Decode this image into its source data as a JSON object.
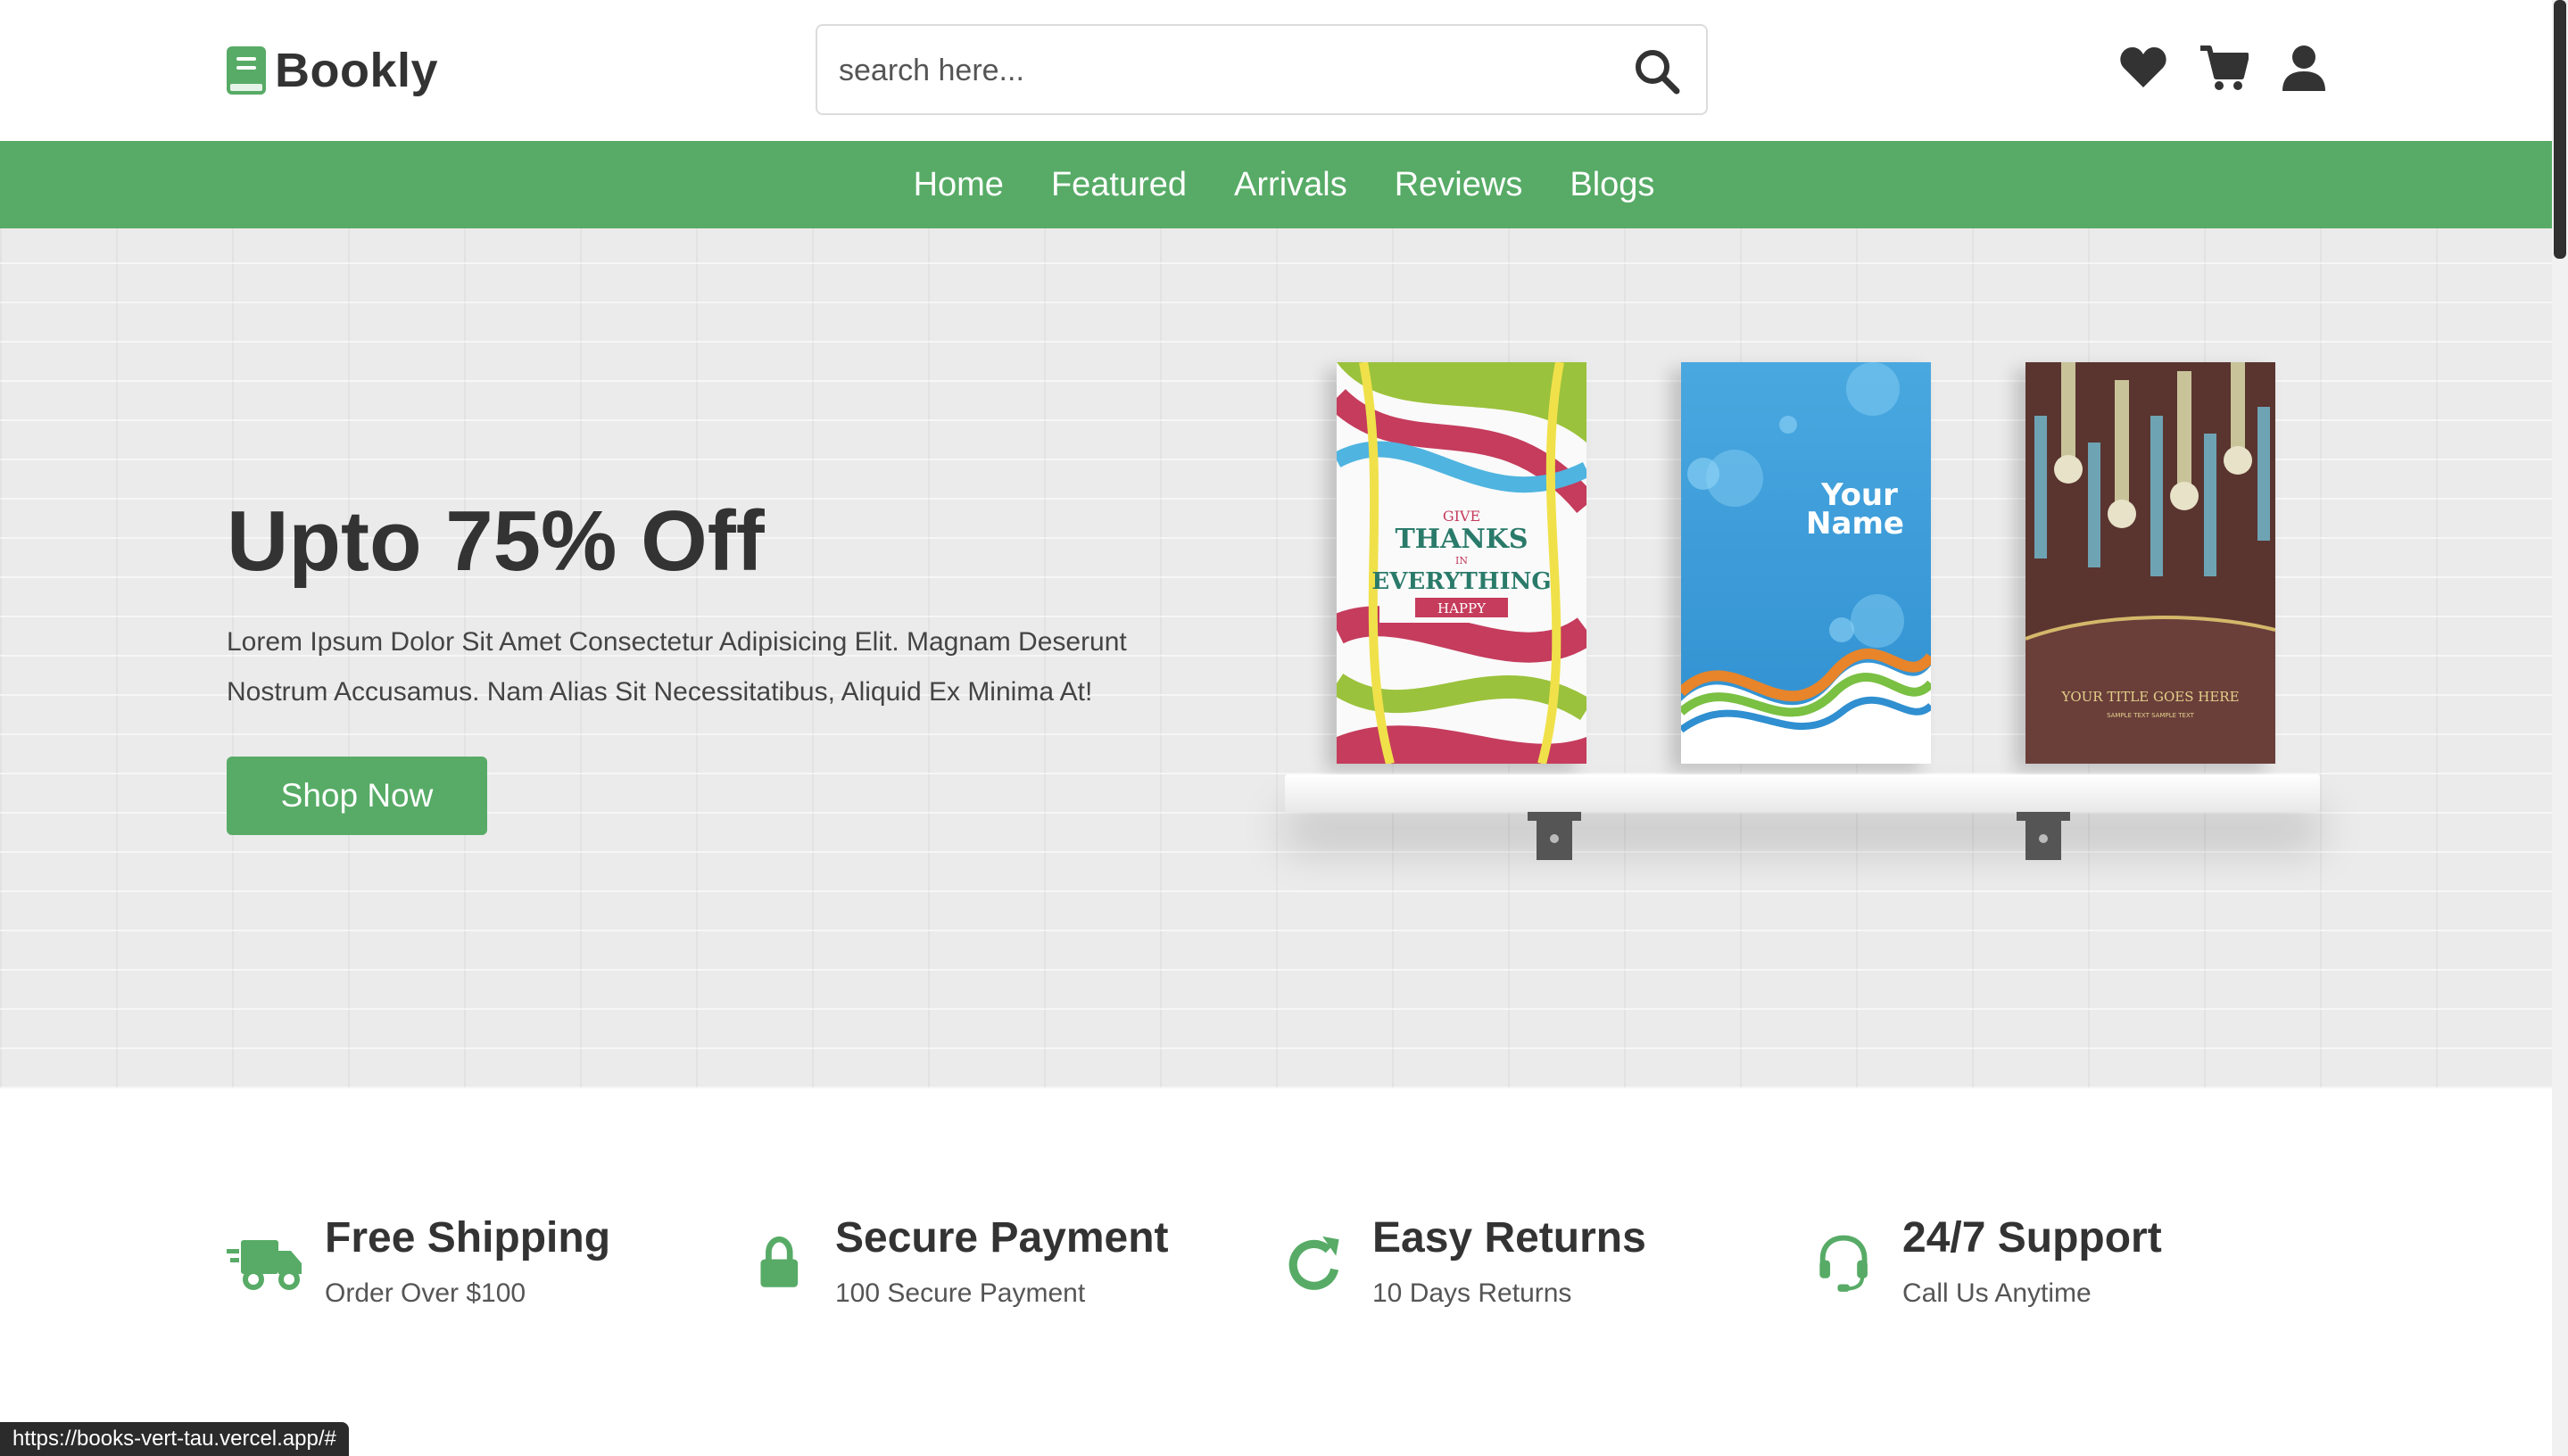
{
  "header": {
    "logo_text": "Bookly",
    "search_placeholder": "search here...",
    "icons": [
      "logo-book-icon",
      "search-icon",
      "heart-icon",
      "cart-icon",
      "user-icon"
    ]
  },
  "nav": {
    "items": [
      {
        "label": "Home"
      },
      {
        "label": "Featured"
      },
      {
        "label": "Arrivals"
      },
      {
        "label": "Reviews"
      },
      {
        "label": "Blogs"
      }
    ]
  },
  "hero": {
    "title": "Upto 75% Off",
    "description": "Lorem Ipsum Dolor Sit Amet Consectetur Adipisicing Elit. Magnam Deserunt Nostrum Accusamus. Nam Alias Sit Necessitatibus, Aliquid Ex Minima At!",
    "button_label": "Shop Now",
    "books": [
      {
        "cover_lines": [
          "GIVE",
          "THANKS",
          "IN",
          "EVERYTHING",
          "HAPPY"
        ]
      },
      {
        "cover_lines": [
          "Your",
          "Name"
        ]
      },
      {
        "cover_lines": [
          "YOUR TITLE GOES HERE",
          "SAMPLE TEXT SAMPLE TEXT"
        ]
      }
    ]
  },
  "features": [
    {
      "icon": "truck-icon",
      "title": "Free Shipping",
      "subtitle": "Order Over $100"
    },
    {
      "icon": "lock-icon",
      "title": "Secure Payment",
      "subtitle": "100 Secure Payment"
    },
    {
      "icon": "redo-icon",
      "title": "Easy Returns",
      "subtitle": "10 Days Returns"
    },
    {
      "icon": "headset-icon",
      "title": "24/7 Support",
      "subtitle": "Call Us Anytime"
    }
  ],
  "status_bar": {
    "url": "https://books-vert-tau.vercel.app/#"
  },
  "colors": {
    "accent": "#57ab66",
    "text": "#333333",
    "hero_bg": "#ebebeb"
  }
}
